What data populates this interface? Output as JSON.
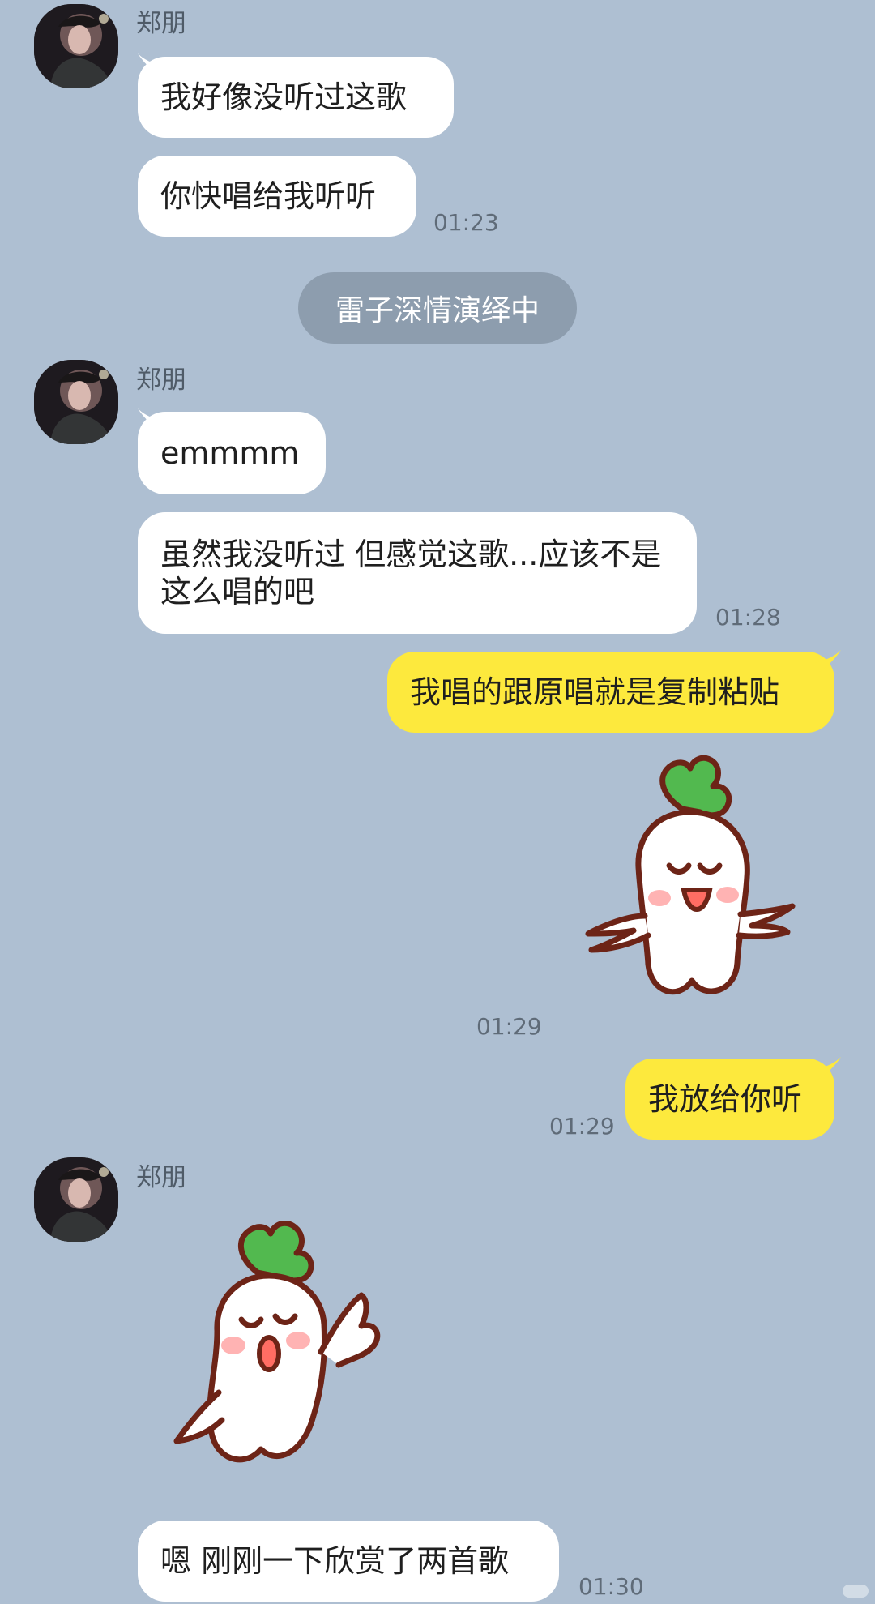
{
  "chat": {
    "groups": [
      {
        "sender": "郑朋",
        "messages": [
          "我好像没听过这歌",
          "你快唱给我听听"
        ],
        "time": "01:23"
      },
      {
        "sender": "郑朋",
        "messages": [
          "emmmm",
          "虽然我没听过 但感觉这歌...应该不是这么唱的吧"
        ],
        "time": "01:28"
      },
      {
        "sender": "郑朋",
        "messages": [
          "嗯 刚刚一下欣赏了两首歌"
        ],
        "time": "01:30"
      }
    ],
    "system_notice": "雷子深情演绎中",
    "mine": {
      "message_1": "我唱的跟原唱就是复制粘贴",
      "sticker_time": "01:29",
      "message_2": "我放给你听",
      "message_2_time": "01:29"
    }
  },
  "icons": {
    "avatar": "profile-photo",
    "sticker_1": "white-radish-sticker",
    "sticker_2": "white-radish-sticker"
  },
  "colors": {
    "background": "#aebfd2",
    "incoming_bubble": "#ffffff",
    "outgoing_bubble": "#fde93d",
    "system_pill": "#8d9dae"
  }
}
